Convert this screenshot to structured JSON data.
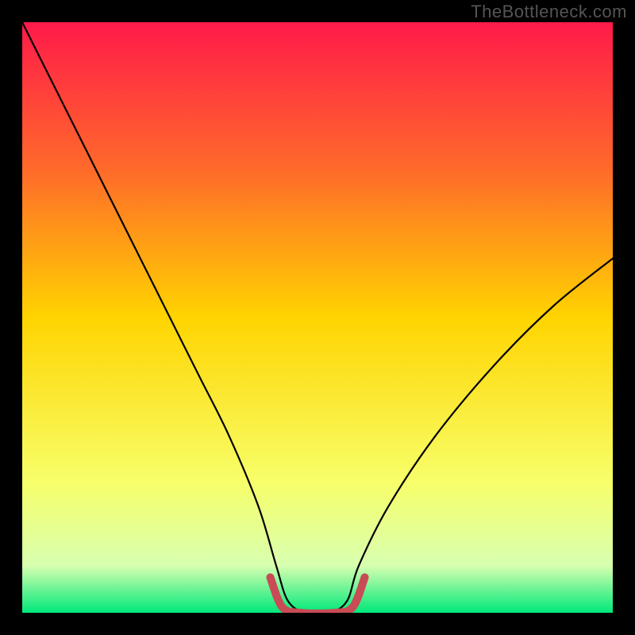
{
  "watermark": "TheBottleneck.com",
  "chart_data": {
    "type": "line",
    "title": "",
    "xlabel": "",
    "ylabel": "",
    "xlim": [
      0,
      100
    ],
    "ylim": [
      0,
      100
    ],
    "background_gradient": {
      "top": "#ff1a4a",
      "mid_upper": "#ff6a2a",
      "mid": "#ffd400",
      "mid_lower": "#f7ff6a",
      "lower": "#d8ffb0",
      "bottom": "#00e87a"
    },
    "series": [
      {
        "name": "bottleneck-curve",
        "stroke": "#000000",
        "x": [
          0,
          5,
          10,
          15,
          20,
          25,
          30,
          35,
          40,
          43,
          45,
          48,
          52,
          55,
          57,
          62,
          70,
          80,
          90,
          100
        ],
        "y": [
          100,
          90,
          80,
          70,
          60,
          50,
          40,
          30,
          18,
          8,
          2,
          0,
          0,
          2,
          8,
          18,
          30,
          42,
          52,
          60
        ]
      },
      {
        "name": "flat-highlight",
        "stroke": "#c84b55",
        "stroke_width": 10,
        "x": [
          42,
          44,
          47,
          53,
          56,
          58
        ],
        "y": [
          6,
          1,
          0,
          0,
          1,
          6
        ]
      }
    ]
  }
}
